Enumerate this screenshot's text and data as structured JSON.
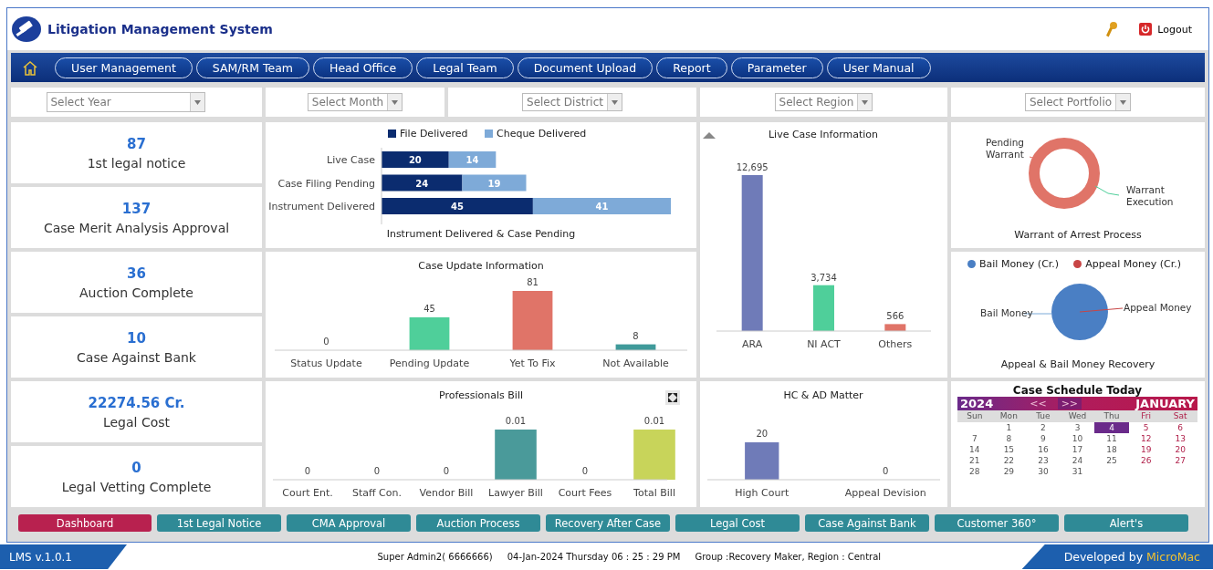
{
  "header": {
    "title": "Litigation Management System",
    "logout": "Logout"
  },
  "nav": [
    {
      "label": "User Management"
    },
    {
      "label": "SAM/RM Team"
    },
    {
      "label": "Head Office"
    },
    {
      "label": "Legal Team"
    },
    {
      "label": "Document Upload"
    },
    {
      "label": "Report"
    },
    {
      "label": "Parameter"
    },
    {
      "label": "User Manual"
    }
  ],
  "filters": [
    {
      "placeholder": "Select Year"
    },
    {
      "placeholder": "Select Month"
    },
    {
      "placeholder": "Select District"
    },
    {
      "placeholder": "Select Region"
    },
    {
      "placeholder": "Select Portfolio"
    }
  ],
  "kpis": [
    {
      "value": "87",
      "label": "1st legal notice"
    },
    {
      "value": "137",
      "label": "Case Merit Analysis Approval"
    },
    {
      "value": "36",
      "label": "Auction Complete"
    },
    {
      "value": "10",
      "label": "Case Against Bank"
    },
    {
      "value": "22274.56 Cr.",
      "label": "Legal Cost"
    },
    {
      "value": "0",
      "label": "Legal Vetting Complete"
    }
  ],
  "instrument_chart": {
    "chart_data": {
      "type": "bar",
      "orientation": "horizontal",
      "stacked": true,
      "title": "Instrument Delivered & Case Pending",
      "categories": [
        "Live Case",
        "Case Filing Pending",
        "Instrument Delivered"
      ],
      "series": [
        {
          "name": "File Delivered",
          "color": "#0b2c6f",
          "values": [
            20,
            24,
            45
          ]
        },
        {
          "name": "Cheque Delivered",
          "color": "#7eaad8",
          "values": [
            14,
            19,
            41
          ]
        }
      ],
      "data_labels": true,
      "legend": true
    }
  },
  "live_case_chart": {
    "chart_data": {
      "type": "bar",
      "title": "Live Case Information",
      "categories": [
        "ARA",
        "NI ACT",
        "Others"
      ],
      "values": [
        12695,
        3734,
        566
      ],
      "value_labels": [
        "12,695",
        "3,734",
        "566"
      ]
    }
  },
  "case_update_chart": {
    "chart_data": {
      "type": "bar",
      "title": "Case Update Information",
      "categories": [
        "Status Update",
        "Pending Update",
        "Yet To Fix",
        "Not Available"
      ],
      "values": [
        0,
        45,
        81,
        8
      ],
      "data_labels": true
    }
  },
  "warrant_chart": {
    "title": "Warrant of Arrest Process",
    "labels": [
      "Pending Warrant",
      "Warrant Execution"
    ]
  },
  "money_chart": {
    "title": "Appeal & Bail Money Recovery",
    "legend": [
      {
        "label": "Bail Money (Cr.)",
        "color": "#4a7fc4"
      },
      {
        "label": "Appeal Money (Cr.)",
        "color": "#c84545"
      }
    ],
    "labels": [
      "Bail Money",
      "Appeal Money"
    ]
  },
  "professionals_chart": {
    "chart_data": {
      "type": "bar",
      "title": "Professionals Bill",
      "categories": [
        "Court Ent.",
        "Staff Con.",
        "Vendor Bill",
        "Lawyer Bill",
        "Court Fees",
        "Total Bill"
      ],
      "values": [
        0,
        0,
        0,
        0.01,
        0,
        0.01
      ],
      "data_labels": true
    }
  },
  "hc_chart": {
    "chart_data": {
      "type": "bar",
      "title": "HC & AD Matter",
      "categories": [
        "High Court",
        "Appeal Devision"
      ],
      "values": [
        20,
        0
      ],
      "data_labels": true
    }
  },
  "calendar": {
    "title": "Case Schedule Today",
    "year": "2024",
    "prev": "<<",
    "next": ">>",
    "month": "JANUARY",
    "weekdays": [
      {
        "label": "Sun",
        "weekend": false
      },
      {
        "label": "Mon",
        "weekend": false
      },
      {
        "label": "Tue",
        "weekend": false
      },
      {
        "label": "Wed",
        "weekend": false
      },
      {
        "label": "Thu",
        "weekend": false
      },
      {
        "label": "Fri",
        "weekend": true
      },
      {
        "label": "Sat",
        "weekend": true
      }
    ],
    "weeks": [
      {
        "days": [
          {
            "day": "1",
            "selected": false
          },
          {
            "day": "2",
            "selected": false
          },
          {
            "day": "3",
            "selected": false
          },
          {
            "day": "4",
            "selected": true
          },
          {
            "day": "5",
            "selected": false
          },
          {
            "day": "6",
            "selected": false
          }
        ]
      },
      {
        "days": [
          {
            "day": "7",
            "selected": false
          },
          {
            "day": "8",
            "selected": false
          },
          {
            "day": "9",
            "selected": false
          },
          {
            "day": "10",
            "selected": false
          },
          {
            "day": "11",
            "selected": false
          },
          {
            "day": "12",
            "selected": false
          },
          {
            "day": "13",
            "selected": false
          }
        ]
      },
      {
        "days": [
          {
            "day": "14",
            "selected": false
          },
          {
            "day": "15",
            "selected": false
          },
          {
            "day": "16",
            "selected": false
          },
          {
            "day": "17",
            "selected": false
          },
          {
            "day": "18",
            "selected": false
          },
          {
            "day": "19",
            "selected": false
          },
          {
            "day": "20",
            "selected": false
          }
        ]
      },
      {
        "days": [
          {
            "day": "21",
            "selected": false
          },
          {
            "day": "22",
            "selected": false
          },
          {
            "day": "23",
            "selected": false
          },
          {
            "day": "24",
            "selected": false
          },
          {
            "day": "25",
            "selected": false
          },
          {
            "day": "26",
            "selected": false
          },
          {
            "day": "27",
            "selected": false
          }
        ]
      },
      {
        "days": [
          {
            "day": "28",
            "selected": false
          },
          {
            "day": "29",
            "selected": false
          },
          {
            "day": "30",
            "selected": false
          },
          {
            "day": "31",
            "selected": false
          }
        ]
      }
    ]
  },
  "bottom_tabs": [
    {
      "label": "Dashboard",
      "selected": true
    },
    {
      "label": "1st Legal Notice",
      "selected": false
    },
    {
      "label": "CMA Approval",
      "selected": false
    },
    {
      "label": "Auction Process",
      "selected": false
    },
    {
      "label": "Recovery After Case",
      "selected": false
    },
    {
      "label": "Legal Cost",
      "selected": false
    },
    {
      "label": "Case Against Bank",
      "selected": false
    },
    {
      "label": "Customer 360°",
      "selected": false
    },
    {
      "label": "Alert's",
      "selected": false
    }
  ],
  "footer": {
    "version": "LMS v.1.0.1",
    "user": "Super Admin2( 6666666)",
    "datetime": "04-Jan-2024 Thursday 06 : 25 : 29 PM",
    "group": "Group :Recovery Maker, Region : Central",
    "developed_by": "Developed by",
    "brand": "MicroMac"
  }
}
